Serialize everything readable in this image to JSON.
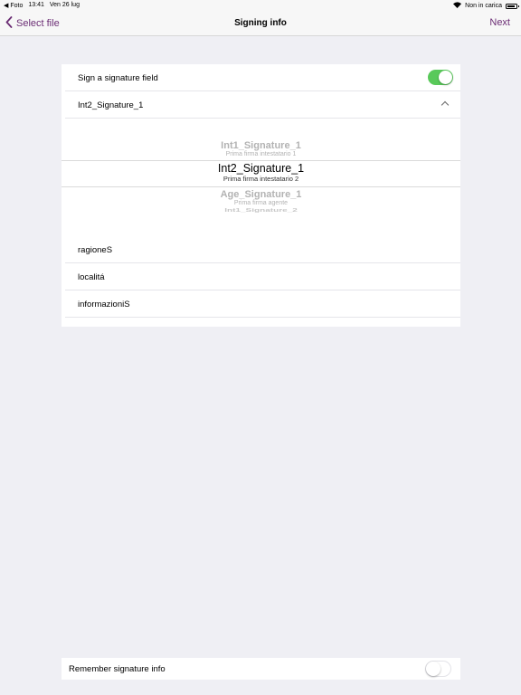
{
  "status_bar": {
    "back_app": "◀ Foto",
    "time": "13:41",
    "date": "Ven 26 lug",
    "charging": "Non in carica"
  },
  "nav": {
    "back_label": "Select file",
    "title": "Signing info",
    "next_label": "Next"
  },
  "form": {
    "sign_field_label": "Sign a signature field",
    "sign_field_enabled": true,
    "selected_field": "Int2_Signature_1",
    "picker_items": [
      {
        "title": "Int1_Signature_1",
        "subtitle": "Prima firma intestatario 1"
      },
      {
        "title": "Int2_Signature_1",
        "subtitle": "Prima firma intestatario 2"
      },
      {
        "title": "Age_Signature_1",
        "subtitle": "Prima firma agente"
      },
      {
        "title": "Int1_Signature_2",
        "subtitle": ""
      }
    ],
    "fields": [
      "ragioneS",
      "localitá",
      "informazioniS"
    ]
  },
  "remember": {
    "label": "Remember signature info",
    "enabled": false
  },
  "colors": {
    "accent": "#6b2d74",
    "toggle_on": "#59c95a",
    "background": "#efeff4"
  }
}
